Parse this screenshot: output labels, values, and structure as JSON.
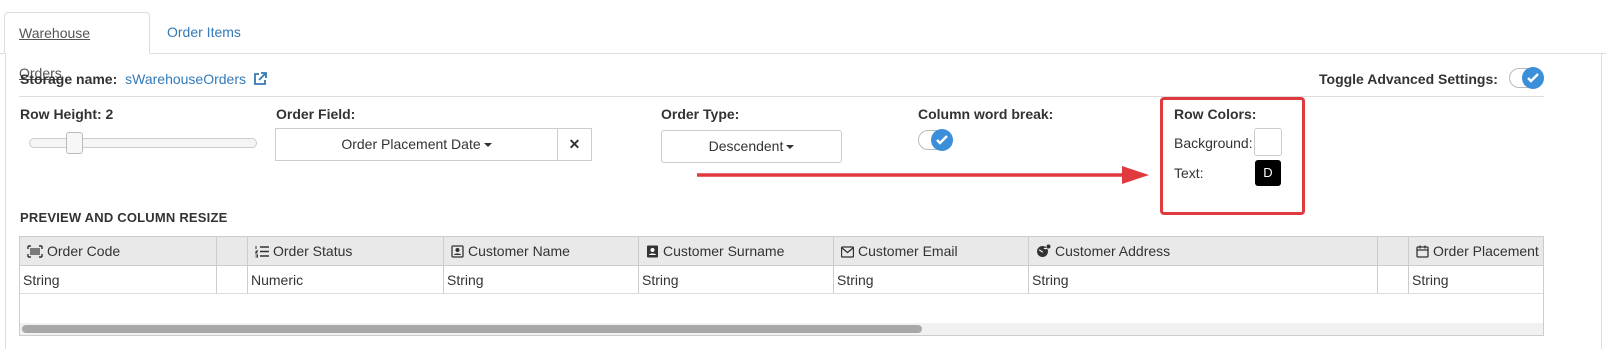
{
  "tabs": [
    {
      "label": "Warehouse Orders",
      "active": true
    },
    {
      "label": "Order Items",
      "active": false
    }
  ],
  "storage": {
    "label": "Storage name:",
    "value": "sWarehouseOrders",
    "icon": "external-link-icon"
  },
  "advanced": {
    "label": "Toggle Advanced Settings:",
    "enabled": true
  },
  "row_height": {
    "label": "Row Height: 2",
    "value": 2
  },
  "order_field": {
    "label": "Order Field:",
    "value": "Order Placement Date",
    "clear": "✕"
  },
  "order_type": {
    "label": "Order Type:",
    "value": "Descendent"
  },
  "column_word_break": {
    "label": "Column word break:",
    "enabled": true
  },
  "row_colors": {
    "label": "Row Colors:",
    "background_label": "Background:",
    "background_color": "#ffffff",
    "text_label": "Text:",
    "text_swatch": "D",
    "text_color": "#000000"
  },
  "annotation": {
    "highlight_color": "#e0393e"
  },
  "preview": {
    "title": "PREVIEW AND COLUMN RESIZE",
    "columns": [
      {
        "name": "Order Code",
        "icon": "barcode-icon",
        "type": "String"
      },
      {
        "name": "",
        "icon": "",
        "type": ""
      },
      {
        "name": "Order Status",
        "icon": "list-ordered-icon",
        "type": "Numeric"
      },
      {
        "name": "Customer Name",
        "icon": "contact-card-icon",
        "type": "String"
      },
      {
        "name": "Customer Surname",
        "icon": "address-book-icon",
        "type": "String"
      },
      {
        "name": "Customer Email",
        "icon": "envelope-icon",
        "type": "String"
      },
      {
        "name": "Customer Address",
        "icon": "globe-marker-icon",
        "type": "String"
      },
      {
        "name": "",
        "icon": "",
        "type": ""
      },
      {
        "name": "Order Placement",
        "icon": "calendar-icon",
        "type": "String"
      }
    ]
  },
  "colors": {
    "link": "#337ab7",
    "accent": "#3b8ed8"
  }
}
